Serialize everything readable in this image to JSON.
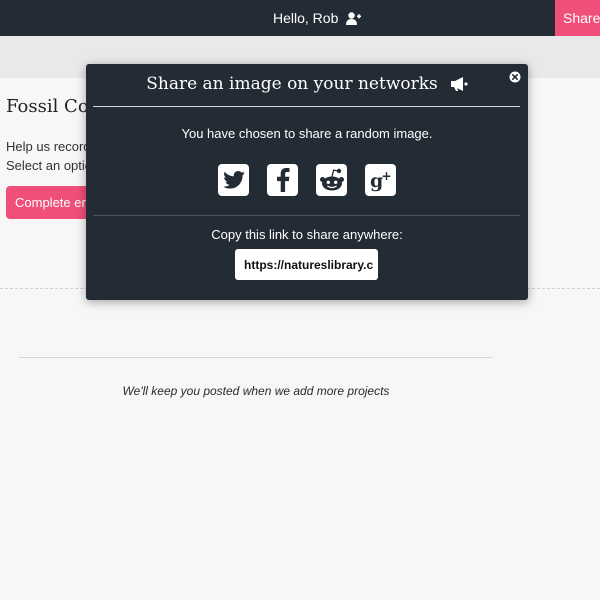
{
  "header": {
    "greeting": "Hello, Rob",
    "greeting_icon": "user-plus-icon",
    "share_button": "Share a"
  },
  "page": {
    "project_title": "Fossil Cora",
    "help_line1": "Help us record",
    "help_line2": "Select an optio",
    "complete_button": "Complete ent",
    "posted_note": "We'll keep you posted when we add more projects"
  },
  "modal": {
    "title": "Share an image on your networks",
    "title_icon": "megaphone-icon",
    "close_icon": "close-icon",
    "chosen_text": "You have chosen to share a random image.",
    "social": [
      {
        "name": "twitter",
        "icon": "twitter-icon"
      },
      {
        "name": "facebook",
        "icon": "facebook-icon"
      },
      {
        "name": "reddit",
        "icon": "reddit-icon"
      },
      {
        "name": "google-plus",
        "icon": "google-plus-icon"
      }
    ],
    "copy_label": "Copy this link to share anywhere:",
    "link_value": "https://natureslibrary.c"
  },
  "colors": {
    "header_bg": "#232b35",
    "accent": "#ef4f78",
    "modal_bg": "#232b35",
    "page_bg": "#f7f7f7"
  }
}
